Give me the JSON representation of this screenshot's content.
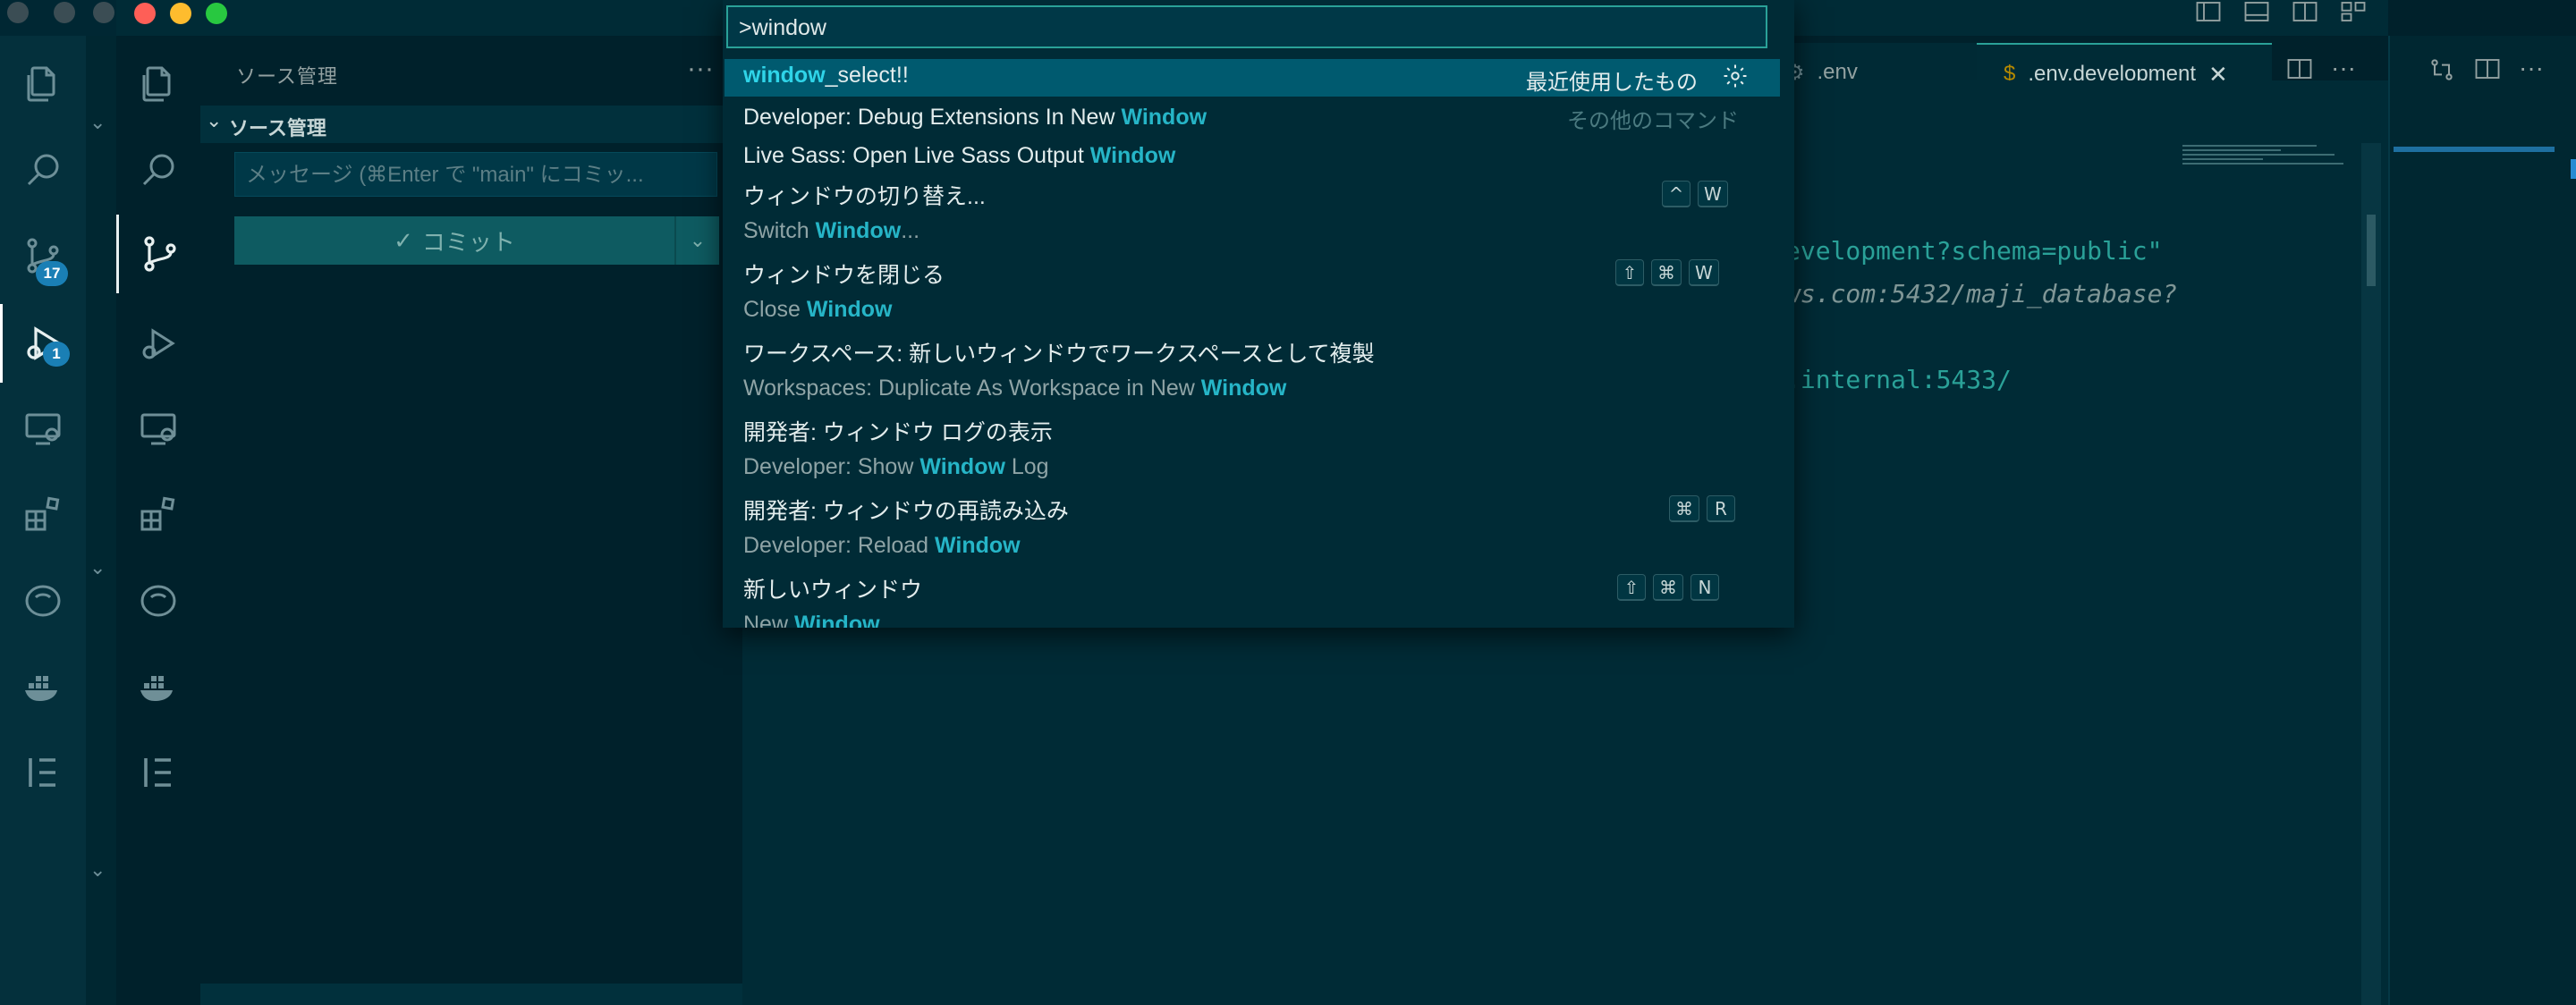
{
  "palette": {
    "input_value": ">window",
    "items": [
      {
        "pre": "",
        "match": "window",
        "post": "_select!!",
        "meta": "最近使用したもの",
        "selected": true
      },
      {
        "pre": "Developer: Debug Extensions In New ",
        "match": "Window",
        "post": "",
        "meta": "その他のコマンド"
      },
      {
        "pre": "Live Sass: Open Live Sass Output ",
        "match": "Window",
        "post": ""
      },
      {
        "jp": "ウィンドウの切り替え...",
        "sub_pre": "Switch ",
        "sub_match": "Window",
        "sub_post": "...",
        "keys": [
          "^",
          "W"
        ]
      },
      {
        "jp": "ウィンドウを閉じる",
        "sub_pre": "Close ",
        "sub_match": "Window",
        "sub_post": "",
        "keys": [
          "⇧",
          "⌘",
          "W"
        ]
      },
      {
        "jp": "ワークスペース: 新しいウィンドウでワークスペースとして複製",
        "sub_pre": "Workspaces: Duplicate As Workspace in New ",
        "sub_match": "Window",
        "sub_post": ""
      },
      {
        "jp": "開発者: ウィンドウ ログの表示",
        "sub_pre": "Developer: Show ",
        "sub_match": "Window",
        "sub_post": " Log"
      },
      {
        "jp": "開発者: ウィンドウの再読み込み",
        "sub_pre": "Developer: Reload ",
        "sub_match": "Window",
        "sub_post": "",
        "keys": [
          "⌘",
          "R"
        ]
      },
      {
        "jp": "新しいウィンドウ",
        "sub_pre": "New ",
        "sub_match": "Window",
        "sub_post": "",
        "keys": [
          "⇧",
          "⌘",
          "N"
        ]
      }
    ]
  },
  "sidebar": {
    "title": "ソース管理",
    "section": "ソース管理",
    "commit_placeholder": "メッセージ (⌘Enter で \"main\" にコミッ...",
    "commit_label": "コミット"
  },
  "activity_badges": {
    "source_control": "17",
    "run_debug": "1"
  },
  "tabs": [
    {
      "label": ".env",
      "icon": "gear-icon"
    },
    {
      "label": ".env.development",
      "icon": "dollar-icon"
    }
  ],
  "editor_lines": [
    "evelopment?schema=public\"",
    "ws.com:5432/maji_database?",
    ".internal:5433/"
  ],
  "colors": {
    "accent": "#2aa198",
    "highlight": "#26b5c7",
    "selection": "#005a6f",
    "background": "#002b36"
  }
}
